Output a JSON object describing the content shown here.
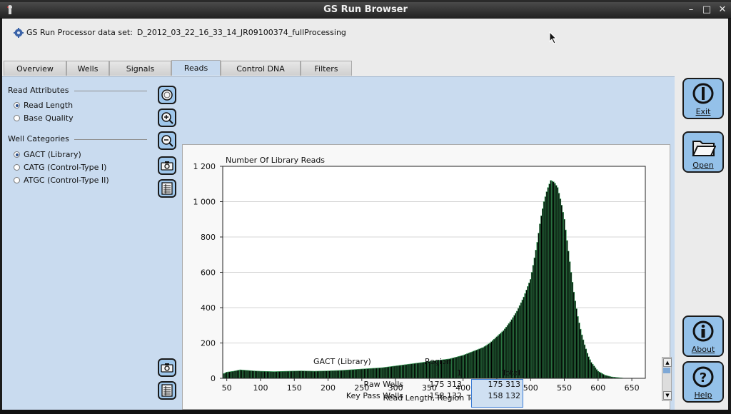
{
  "window": {
    "title": "GS Run Browser",
    "controls": [
      "minimize",
      "maximize",
      "close"
    ]
  },
  "dataset": {
    "label": "GS Run Processor data set:",
    "value": "D_2012_03_22_16_33_14_JR09100374_fullProcessing"
  },
  "tabs": [
    {
      "label": "Overview",
      "active": false
    },
    {
      "label": "Wells",
      "active": false
    },
    {
      "label": "Signals",
      "active": false
    },
    {
      "label": "Reads",
      "active": true
    },
    {
      "label": "Control DNA",
      "active": false
    },
    {
      "label": "Filters",
      "active": false
    }
  ],
  "read_attributes": {
    "title": "Read Attributes",
    "options": [
      {
        "label": "Read Length",
        "selected": true
      },
      {
        "label": "Base Quality",
        "selected": false
      }
    ]
  },
  "well_categories": {
    "title": "Well Categories",
    "options": [
      {
        "label": "GACT (Library)",
        "selected": true
      },
      {
        "label": "CATG (Control-Type I)",
        "selected": false
      },
      {
        "label": "ATGC (Control-Type II)",
        "selected": false
      }
    ]
  },
  "toolbar_icons": [
    "reset-zoom-icon",
    "zoom-in-icon",
    "zoom-out-icon",
    "snapshot-icon",
    "table-icon"
  ],
  "right_buttons": [
    {
      "label": "Exit",
      "icon": "exit-icon"
    },
    {
      "label": "Open",
      "icon": "folder-icon"
    },
    {
      "label": "About",
      "icon": "info-icon"
    },
    {
      "label": "Help",
      "icon": "help-icon"
    }
  ],
  "chart_data": {
    "type": "bar",
    "title": "Number Of Library Reads",
    "xlabel": "Read Length, Region Total",
    "ylabel": "",
    "xlim": [
      44,
      670
    ],
    "ylim": [
      0,
      1200
    ],
    "xticks": [
      50,
      100,
      150,
      200,
      250,
      300,
      350,
      400,
      450,
      500,
      550,
      600,
      650
    ],
    "yticks": [
      0,
      200,
      400,
      600,
      800,
      1000,
      1200
    ],
    "ytick_labels": [
      "0",
      "200",
      "400",
      "600",
      "800",
      "1 000",
      "1 200"
    ],
    "grid": true,
    "colors": {
      "bars": "#000000",
      "bar_outline": "#3aa05a",
      "grid": "#d4d4d4"
    },
    "series": [
      {
        "x": [
          45,
          50,
          60,
          70,
          80,
          90,
          100,
          120,
          140,
          160,
          180,
          200,
          220,
          240,
          260,
          280,
          300,
          320,
          340,
          360,
          380,
          400,
          410,
          420,
          430,
          440,
          450,
          460,
          470,
          480,
          490,
          500,
          505,
          510,
          515,
          520,
          525,
          530,
          535,
          540,
          545,
          550,
          555,
          560,
          565,
          570,
          575,
          580,
          585,
          590,
          600,
          610,
          620,
          630,
          640
        ],
        "values": [
          25,
          35,
          40,
          48,
          45,
          42,
          40,
          38,
          40,
          42,
          40,
          42,
          45,
          50,
          55,
          60,
          70,
          80,
          90,
          100,
          110,
          130,
          145,
          160,
          175,
          200,
          235,
          270,
          320,
          380,
          460,
          560,
          660,
          770,
          900,
          1000,
          1070,
          1120,
          1110,
          1080,
          1000,
          900,
          750,
          600,
          460,
          350,
          260,
          190,
          130,
          90,
          40,
          18,
          8,
          4,
          0
        ]
      }
    ]
  },
  "stats_table": {
    "category": "GACT (Library)",
    "region_header": "Region",
    "col_1": "1",
    "col_total": "Total",
    "rows": [
      {
        "label": "Raw Wells",
        "region1": "175 313",
        "total": "175 313"
      },
      {
        "label": "Key Pass Wells",
        "region1": "158 132",
        "total": "158 132"
      }
    ]
  }
}
